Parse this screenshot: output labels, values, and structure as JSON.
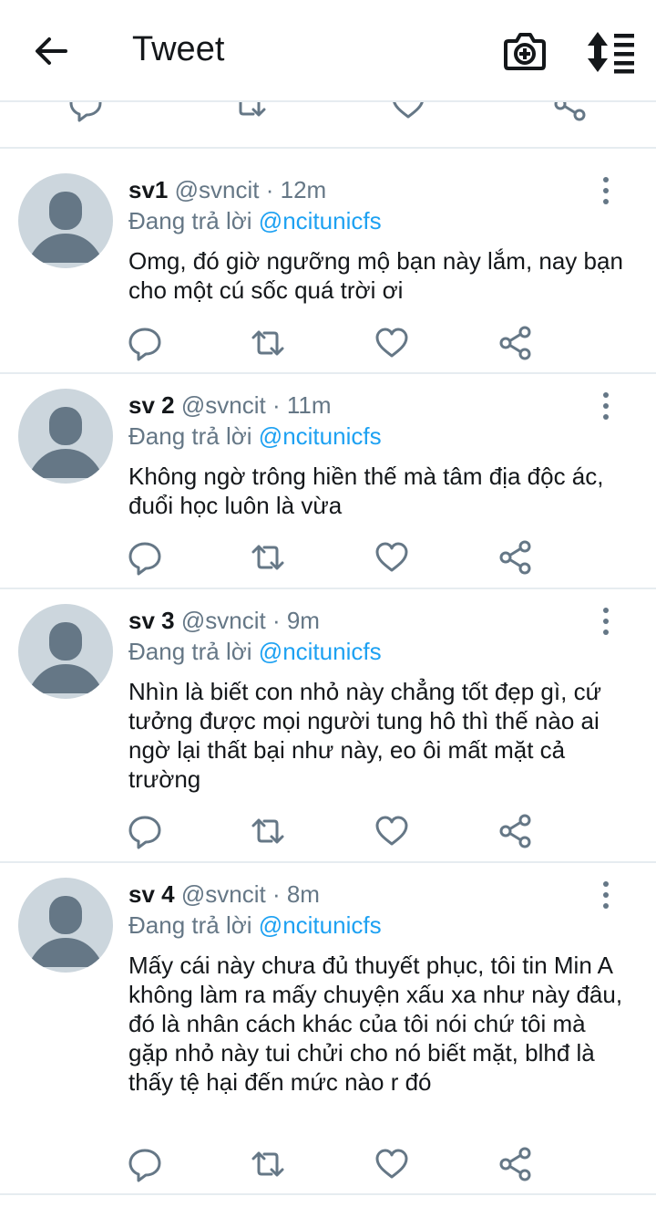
{
  "header": {
    "title": "Tweet"
  },
  "tweets": [
    {
      "name": "sv1",
      "handle": "@svncit",
      "time": "12m",
      "reply_prefix": "Đang trả lời",
      "reply_to": "@ncitunicfs",
      "text": "Omg, đó giờ ngưỡng mộ bạn này lắm, nay bạn cho một cú sốc quá trời ơi"
    },
    {
      "name": "sv 2",
      "handle": "@svncit",
      "time": "11m",
      "reply_prefix": "Đang trả lời",
      "reply_to": "@ncitunicfs",
      "text": "Không ngờ trông hiền thế mà tâm địa độc ác, đuổi học luôn là vừa"
    },
    {
      "name": "sv 3",
      "handle": "@svncit",
      "time": "9m",
      "reply_prefix": "Đang trả lời",
      "reply_to": "@ncitunicfs",
      "text": "Nhìn là biết con nhỏ này chẳng tốt đẹp gì, cứ tưởng được mọi người tung hô thì thế nào ai ngờ lại thất bại như này, eo ôi mất mặt cả trường"
    },
    {
      "name": "sv 4",
      "handle": "@svncit",
      "time": "8m",
      "reply_prefix": "Đang trả lời",
      "reply_to": "@ncitunicfs",
      "text": "Mấy cái này chưa đủ thuyết phục, tôi tin Min A không làm ra mấy chuyện xấu xa như này đâu, đó là nhân cách khác của tôi nói chứ tôi mà gặp nhỏ này tui chửi cho nó biết mặt, blhđ là thấy tệ hại đến mức nào r đó"
    }
  ],
  "colors": {
    "accent": "#1da1f2",
    "icon": "#657786",
    "divider": "#e6ecf0",
    "avatar_bg": "#ccd6dd",
    "avatar_fg": "#657786"
  },
  "icons": [
    "back-arrow-icon",
    "camera-plus-icon",
    "sort-icon",
    "reply-icon",
    "retweet-icon",
    "like-icon",
    "share-icon",
    "more-vertical-icon"
  ]
}
